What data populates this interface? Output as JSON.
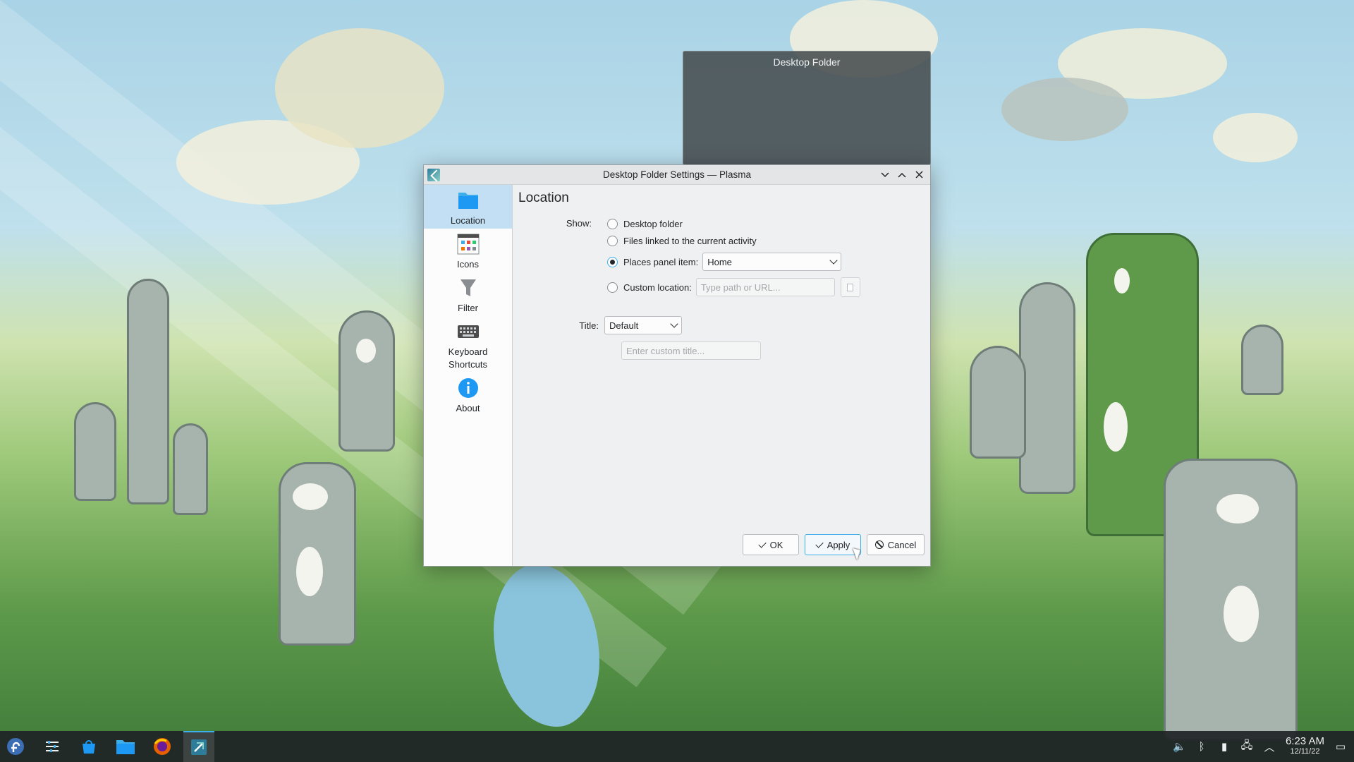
{
  "plasmoid": {
    "title": "Desktop Folder"
  },
  "dialog": {
    "title": "Desktop Folder Settings — Plasma",
    "sidebar": [
      {
        "label": "Location",
        "icon": "folder-icon",
        "active": true
      },
      {
        "label": "Icons",
        "icon": "icons-grid-icon",
        "active": false
      },
      {
        "label": "Filter",
        "icon": "filter-icon",
        "active": false
      },
      {
        "label": "Keyboard Shortcuts",
        "icon": "keyboard-icon",
        "active": false
      },
      {
        "label": "About",
        "icon": "info-icon",
        "active": false
      }
    ],
    "page_title": "Location",
    "show_label": "Show:",
    "options": {
      "desktop_folder": "Desktop folder",
      "files_linked": "Files linked to the current activity",
      "places_panel": "Places panel item:",
      "custom_location": "Custom location:"
    },
    "selected_option": "places_panel",
    "places_combo_value": "Home",
    "custom_location_placeholder": "Type path or URL...",
    "title_label": "Title:",
    "title_combo_value": "Default",
    "custom_title_placeholder": "Enter custom title...",
    "buttons": {
      "ok": "OK",
      "apply": "Apply",
      "cancel": "Cancel"
    }
  },
  "taskbar": {
    "clock_time": "6:23 AM",
    "clock_date": "12/11/22"
  },
  "colors": {
    "accent": "#3daee9",
    "selection": "#c2dff3",
    "taskbar": "#202326"
  }
}
